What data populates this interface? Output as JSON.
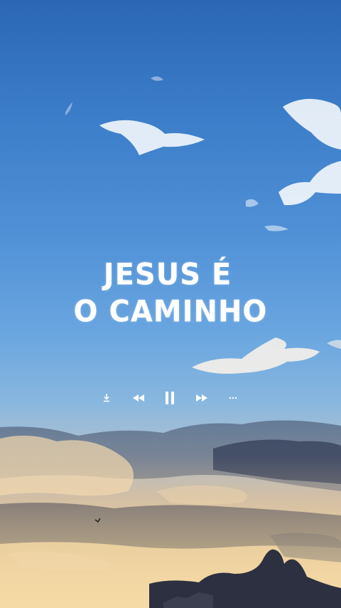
{
  "wallpaper": {
    "quote_line_1": "JESUS É",
    "quote_line_2": "O CAMINHO"
  },
  "media_controls": {
    "buttons": [
      "download-icon",
      "rewind-icon",
      "pause-icon",
      "fast-forward-icon",
      "more-icon"
    ]
  },
  "colors": {
    "sky_top": "#2a66b4",
    "sky_horizon": "#f0d8a8",
    "text": "#ffffff",
    "clouds_dark": "#3d4a63",
    "mountain": "#2c3040"
  }
}
